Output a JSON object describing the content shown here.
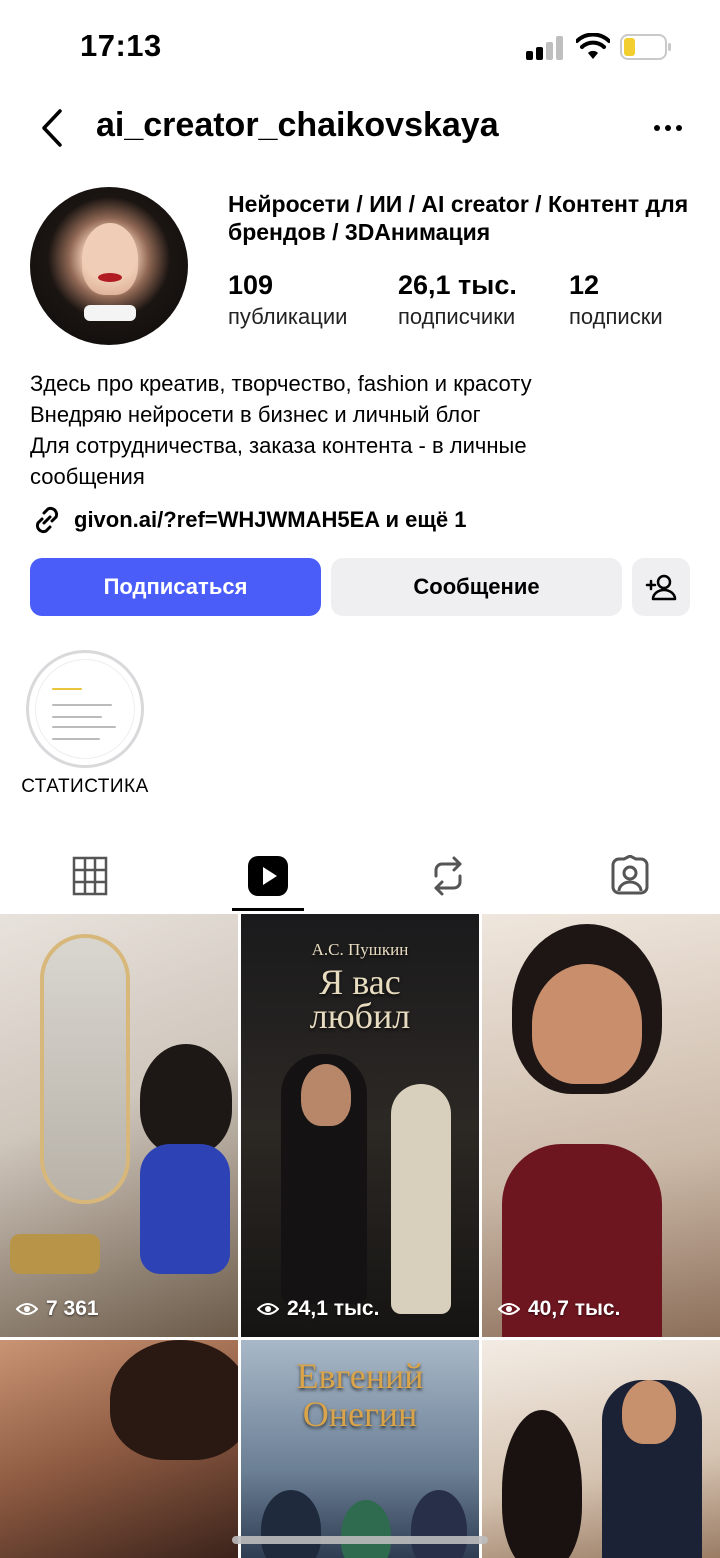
{
  "status_bar": {
    "time": "17:13"
  },
  "header": {
    "username": "ai_creator_chaikovskaya"
  },
  "profile": {
    "display_name": "Нейросети / ИИ / AI creator / Контент для брендов / 3DАнимация",
    "stats": [
      {
        "value": "109",
        "label": "публикации"
      },
      {
        "value": "26,1 тыс.",
        "label": "подписчики"
      },
      {
        "value": "12",
        "label": "подписки"
      }
    ],
    "bio": [
      "Здесь про креатив, творчество, fashion и красоту",
      "Внедряю нейросети в бизнес и личный блог",
      "Для сотрудничества, заказа контента - в личные сообщения"
    ],
    "link": "givon.ai/?ref=WHJWMAH5EA и ещё 1"
  },
  "actions": {
    "follow_label": "Подписаться",
    "message_label": "Сообщение"
  },
  "highlights": [
    {
      "label": "СТАТИСТИКА"
    }
  ],
  "tabs": [
    {
      "icon": "grid-icon"
    },
    {
      "icon": "reels-icon",
      "active": true
    },
    {
      "icon": "reposts-icon"
    },
    {
      "icon": "tagged-icon"
    }
  ],
  "posts": [
    {
      "views": "7 361"
    },
    {
      "views": "24,1 тыс.",
      "author": "А.С. Пушкин",
      "title_line1": "Я вас",
      "title_line2": "любил"
    },
    {
      "views": "40,7 тыс."
    },
    {
      "views": ""
    },
    {
      "views": "",
      "title_line1": "Евгений",
      "title_line2": "Онегин"
    },
    {
      "views": ""
    }
  ],
  "colors": {
    "accent": "#4a5df9",
    "secondary_button": "#efeff1"
  }
}
